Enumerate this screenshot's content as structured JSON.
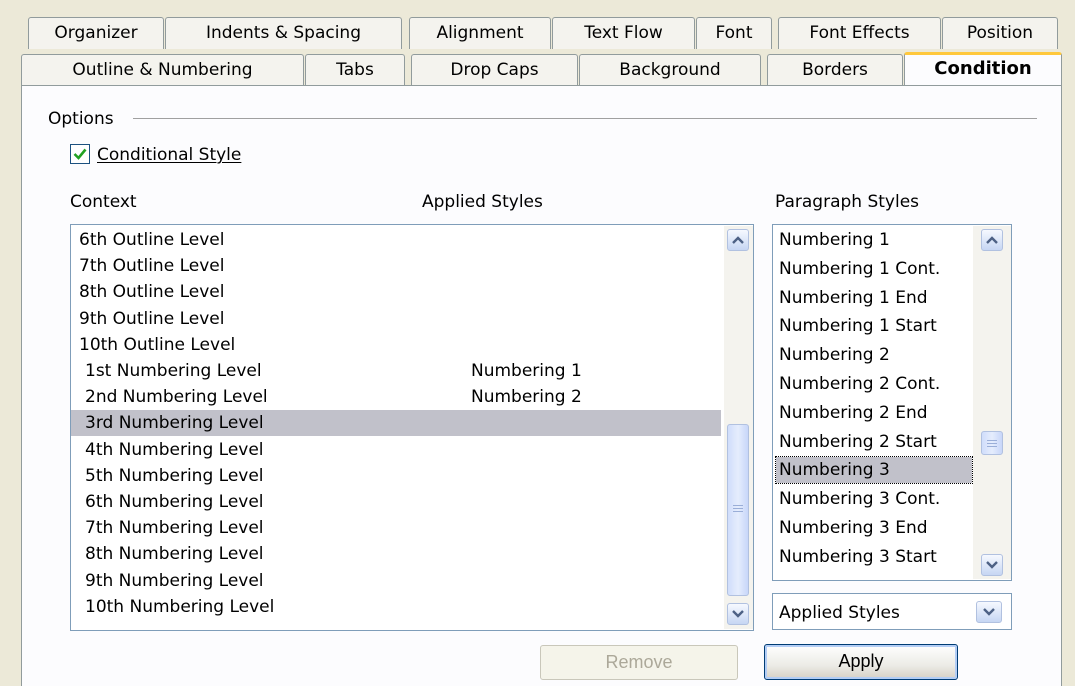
{
  "tabs_row1": [
    "Organizer",
    "Indents & Spacing",
    "Alignment",
    "Text Flow",
    "Font",
    "Font Effects",
    "Position"
  ],
  "tabs_row2": [
    "Outline & Numbering",
    "Tabs",
    "Drop Caps",
    "Background",
    "Borders",
    "Condition"
  ],
  "active_tab": "Condition",
  "options_label": "Options",
  "conditional_style_label": "Conditional Style",
  "conditional_style_checked": true,
  "context_label": "Context",
  "applied_styles_label": "Applied Styles",
  "paragraph_styles_label": "Paragraph Styles",
  "context_rows": [
    {
      "context": "6th Outline Level",
      "applied": ""
    },
    {
      "context": "7th Outline Level",
      "applied": ""
    },
    {
      "context": "8th Outline Level",
      "applied": ""
    },
    {
      "context": "9th Outline Level",
      "applied": ""
    },
    {
      "context": "10th Outline Level",
      "applied": ""
    },
    {
      "context": "1st Numbering Level",
      "applied": "Numbering 1"
    },
    {
      "context": "2nd Numbering Level",
      "applied": "Numbering 2"
    },
    {
      "context": "3rd Numbering Level",
      "applied": "",
      "selected": true
    },
    {
      "context": "4th Numbering Level",
      "applied": ""
    },
    {
      "context": "5th Numbering Level",
      "applied": ""
    },
    {
      "context": "6th Numbering Level",
      "applied": ""
    },
    {
      "context": "7th Numbering Level",
      "applied": ""
    },
    {
      "context": "8th Numbering Level",
      "applied": ""
    },
    {
      "context": "9th Numbering Level",
      "applied": ""
    },
    {
      "context": "10th Numbering Level",
      "applied": ""
    }
  ],
  "paragraph_styles": [
    {
      "name": "Numbering 1"
    },
    {
      "name": "Numbering 1 Cont."
    },
    {
      "name": "Numbering 1 End"
    },
    {
      "name": "Numbering 1 Start"
    },
    {
      "name": "Numbering 2"
    },
    {
      "name": "Numbering 2 Cont."
    },
    {
      "name": "Numbering 2 End"
    },
    {
      "name": "Numbering 2 Start"
    },
    {
      "name": "Numbering 3",
      "selected": true
    },
    {
      "name": "Numbering 3 Cont."
    },
    {
      "name": "Numbering 3 End"
    },
    {
      "name": "Numbering 3 Start"
    }
  ],
  "filter_select_value": "Applied Styles",
  "remove_button_label": "Remove",
  "apply_button_label": "Apply",
  "colors": {
    "active_tab_accent": "#ffc83c",
    "selection": "#c1c1ca",
    "check_green": "#21a121"
  }
}
